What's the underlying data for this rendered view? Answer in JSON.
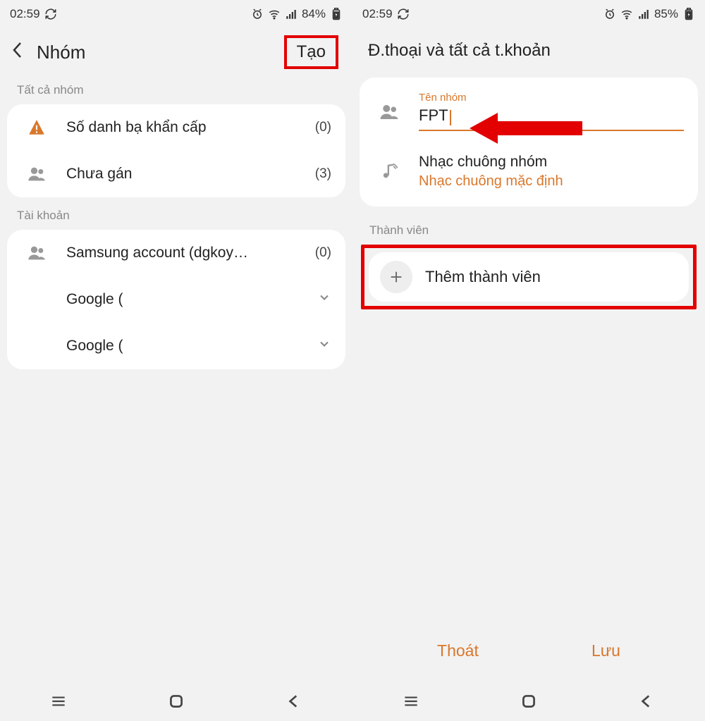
{
  "left": {
    "status": {
      "time": "02:59",
      "battery": "84%"
    },
    "header": {
      "title": "Nhóm",
      "action": "Tạo"
    },
    "section_all_groups": "Tất cả nhóm",
    "groups": [
      {
        "label": "Số danh bạ khẩn cấp",
        "count": "(0)"
      },
      {
        "label": "Chưa gán",
        "count": "(3)"
      }
    ],
    "section_accounts": "Tài khoản",
    "accounts": [
      {
        "label": "Samsung account (dgkoy…",
        "count": "(0)"
      },
      {
        "label": "Google ("
      },
      {
        "label": "Google ("
      }
    ]
  },
  "right": {
    "status": {
      "time": "02:59",
      "battery": "85%"
    },
    "header_title": "Đ.thoại và tất cả t.khoản",
    "group_name_label": "Tên nhóm",
    "group_name_value": "FPT",
    "ringtone_label": "Nhạc chuông nhóm",
    "ringtone_value": "Nhạc chuông mặc định",
    "members_label": "Thành viên",
    "add_member_label": "Thêm thành viên",
    "cancel": "Thoát",
    "save": "Lưu"
  }
}
